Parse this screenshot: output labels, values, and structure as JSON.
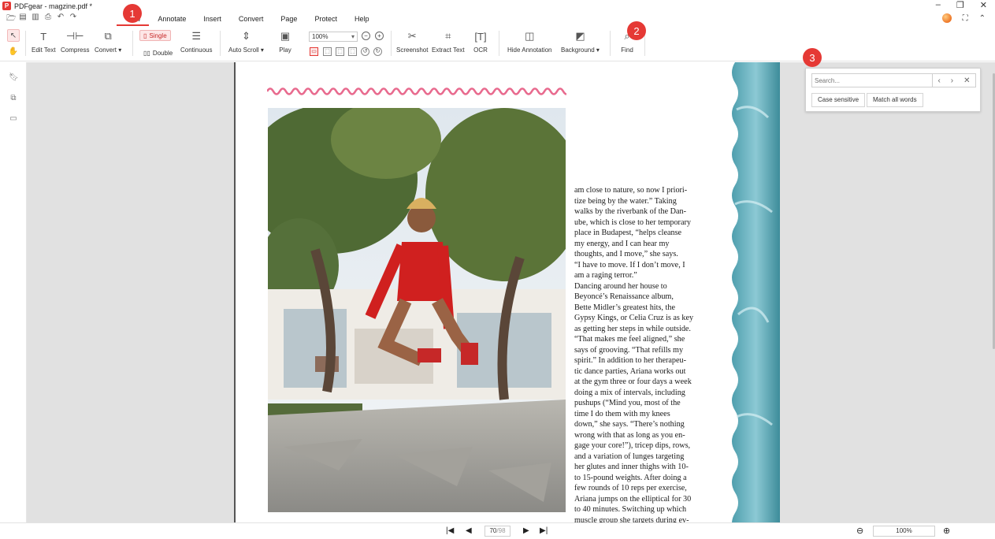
{
  "window": {
    "title": "PDFgear - magzine.pdf *",
    "logo_letter": "P"
  },
  "menu": {
    "tabs": [
      "View",
      "Annotate",
      "Insert",
      "Convert",
      "Page",
      "Protect",
      "Help"
    ],
    "active": "View"
  },
  "ribbon": {
    "edit_text": "Edit Text",
    "compress": "Compress",
    "convert": "Convert ▾",
    "single": "Single",
    "double": "Double",
    "continuous": "Continuous",
    "auto_scroll": "Auto Scroll ▾",
    "play": "Play",
    "zoom_value": "100%",
    "screenshot": "Screenshot",
    "extract_text": "Extract Text",
    "ocr": "OCR",
    "hide_annotation": "Hide Annotation",
    "background": "Background ▾",
    "find": "Find"
  },
  "badges": [
    "1",
    "2",
    "3"
  ],
  "search": {
    "placeholder": "Search...",
    "case_sensitive": "Case sensitive",
    "match_all_words": "Match all words"
  },
  "document": {
    "body_text": "am close to nature, so now I priori-\ntize being by the water.” Taking\nwalks by the riverbank of the Dan-\nube, which is close to her temporary\nplace in Budapest, “helps cleanse\nmy energy, and I can hear my\nthoughts, and I move,” she says.\n“I have to move. If I don’t move, I\nam a raging terror.”\n    Dancing around her house to\nBeyoncé’s Renaissance album,\nBette Midler’s greatest hits, the\nGypsy Kings, or Celia Cruz is as key\nas getting her steps in while outside.\n“That makes me feel aligned,” she\nsays of grooving. “That refills my\nspirit.” In addition to her therapeu-\ntic dance parties, Ariana works out\nat the gym three or four days a week\ndoing a mix of intervals, including\npushups (“Mind you, most of the\ntime I do them with my knees\ndown,” she says. “There’s nothing\nwrong with that as long as you en-\ngage your core!”), tricep dips, rows,\nand a variation of lunges targeting\nher glutes and inner thighs with 10-\nto 15-pound weights. After doing a\nfew rounds of 10 reps per exercise,\nAriana jumps on the elliptical for 30\nto 40 minutes. Switching up which\nmuscle group she targets during ev-"
  },
  "footer": {
    "current_page": "70",
    "total_pages": "/98",
    "zoom": "100%"
  },
  "colors": {
    "accent": "#e53935",
    "wave": "#e86a8e"
  }
}
